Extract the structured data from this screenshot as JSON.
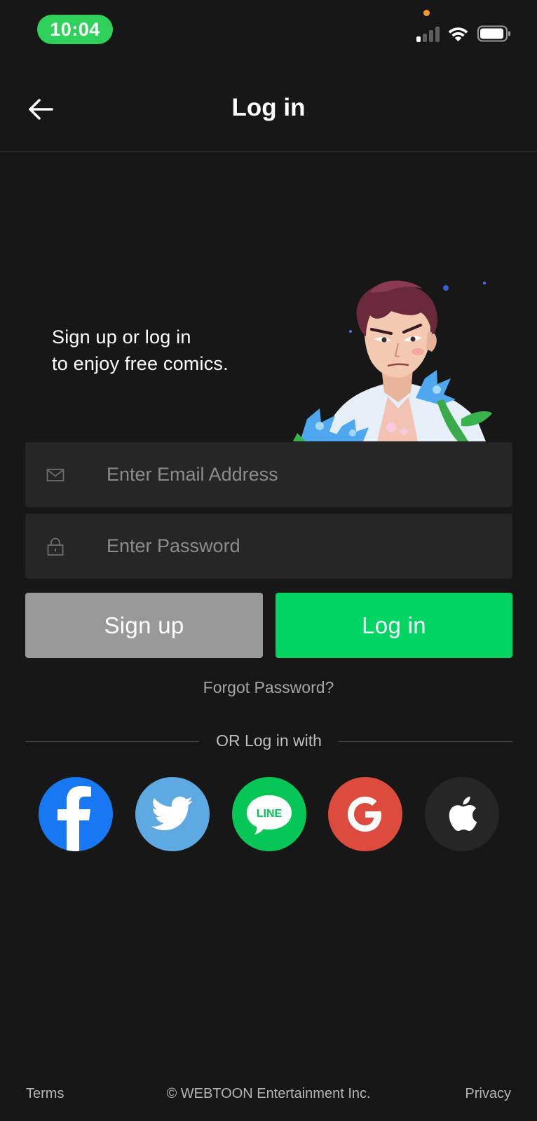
{
  "status_bar": {
    "time": "10:04"
  },
  "header": {
    "title": "Log in"
  },
  "hero": {
    "line1": "Sign up or log in",
    "line2": "to enjoy free comics."
  },
  "form": {
    "email_placeholder": "Enter Email Address",
    "password_placeholder": "Enter Password"
  },
  "buttons": {
    "signup_label": "Sign up",
    "login_label": "Log in"
  },
  "forgot_label": "Forgot Password?",
  "divider_label": "OR Log in with",
  "social": {
    "line_label": "LINE",
    "colors": {
      "facebook": "#1877f2",
      "twitter": "#5ea9e1",
      "line": "#06c755",
      "google": "#dd4b3e",
      "apple": "#262626"
    }
  },
  "footer": {
    "terms_label": "Terms",
    "copyright": "© WEBTOON Entertainment Inc.",
    "privacy_label": "Privacy"
  },
  "colors": {
    "accent": "#00d564",
    "background": "#171717",
    "field": "#262626",
    "signup_button": "#999999"
  }
}
